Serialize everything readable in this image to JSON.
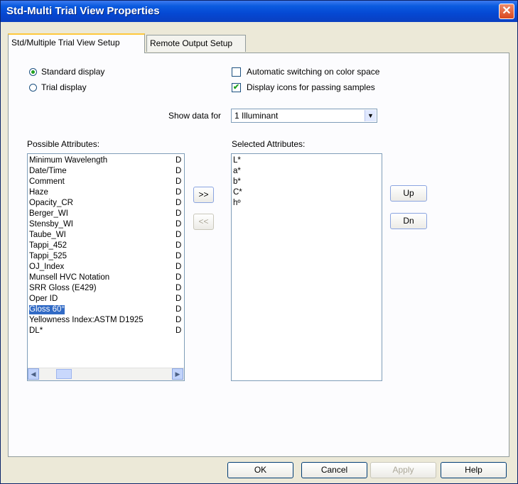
{
  "window": {
    "title": "Std-Multi Trial View Properties"
  },
  "tabs": [
    {
      "label": "Std/Multiple Trial View Setup",
      "active": true
    },
    {
      "label": "Remote Output Setup",
      "active": false
    }
  ],
  "display_mode": {
    "standard_label": "Standard display",
    "trial_label": "Trial display",
    "selected": "Standard display"
  },
  "options": {
    "auto_switch_label": "Automatic switching on color space",
    "auto_switch_checked": false,
    "display_icons_label": "Display icons for passing samples",
    "display_icons_checked": true
  },
  "show_data": {
    "label": "Show data for",
    "value": "1 Illuminant"
  },
  "possible": {
    "label": "Possible Attributes:",
    "items": [
      {
        "name": "Minimum Wavelength",
        "flag": "D"
      },
      {
        "name": "Date/Time",
        "flag": "D"
      },
      {
        "name": "Comment",
        "flag": "D"
      },
      {
        "name": "Haze",
        "flag": "D"
      },
      {
        "name": "Opacity_CR",
        "flag": "D"
      },
      {
        "name": "Berger_WI",
        "flag": "D"
      },
      {
        "name": "Stensby_WI",
        "flag": "D"
      },
      {
        "name": "Taube_WI",
        "flag": "D"
      },
      {
        "name": "Tappi_452",
        "flag": "D"
      },
      {
        "name": "Tappi_525",
        "flag": "D"
      },
      {
        "name": "OJ_Index",
        "flag": "D"
      },
      {
        "name": "Munsell HVC Notation",
        "flag": "D"
      },
      {
        "name": "SRR Gloss (E429)",
        "flag": "D"
      },
      {
        "name": "Oper ID",
        "flag": "D"
      },
      {
        "name": "Gloss 60°",
        "flag": "D",
        "selected": true
      },
      {
        "name": "Yellowness Index:ASTM D1925",
        "flag": "D"
      },
      {
        "name": "DL*",
        "flag": "D"
      }
    ]
  },
  "selected_attrs": {
    "label": "Selected Attributes:",
    "items": [
      "L*",
      "a*",
      "b*",
      "C*",
      "hº"
    ]
  },
  "transfer": {
    "add_label": ">>",
    "remove_label": "<<"
  },
  "order": {
    "up_label": "Up",
    "down_label": "Dn"
  },
  "footer": {
    "ok": "OK",
    "cancel": "Cancel",
    "apply": "Apply",
    "help": "Help"
  },
  "colors": {
    "title_bar": "#0548D3",
    "selection": "#316AC5",
    "dialog_bg": "#ECE9D8"
  }
}
